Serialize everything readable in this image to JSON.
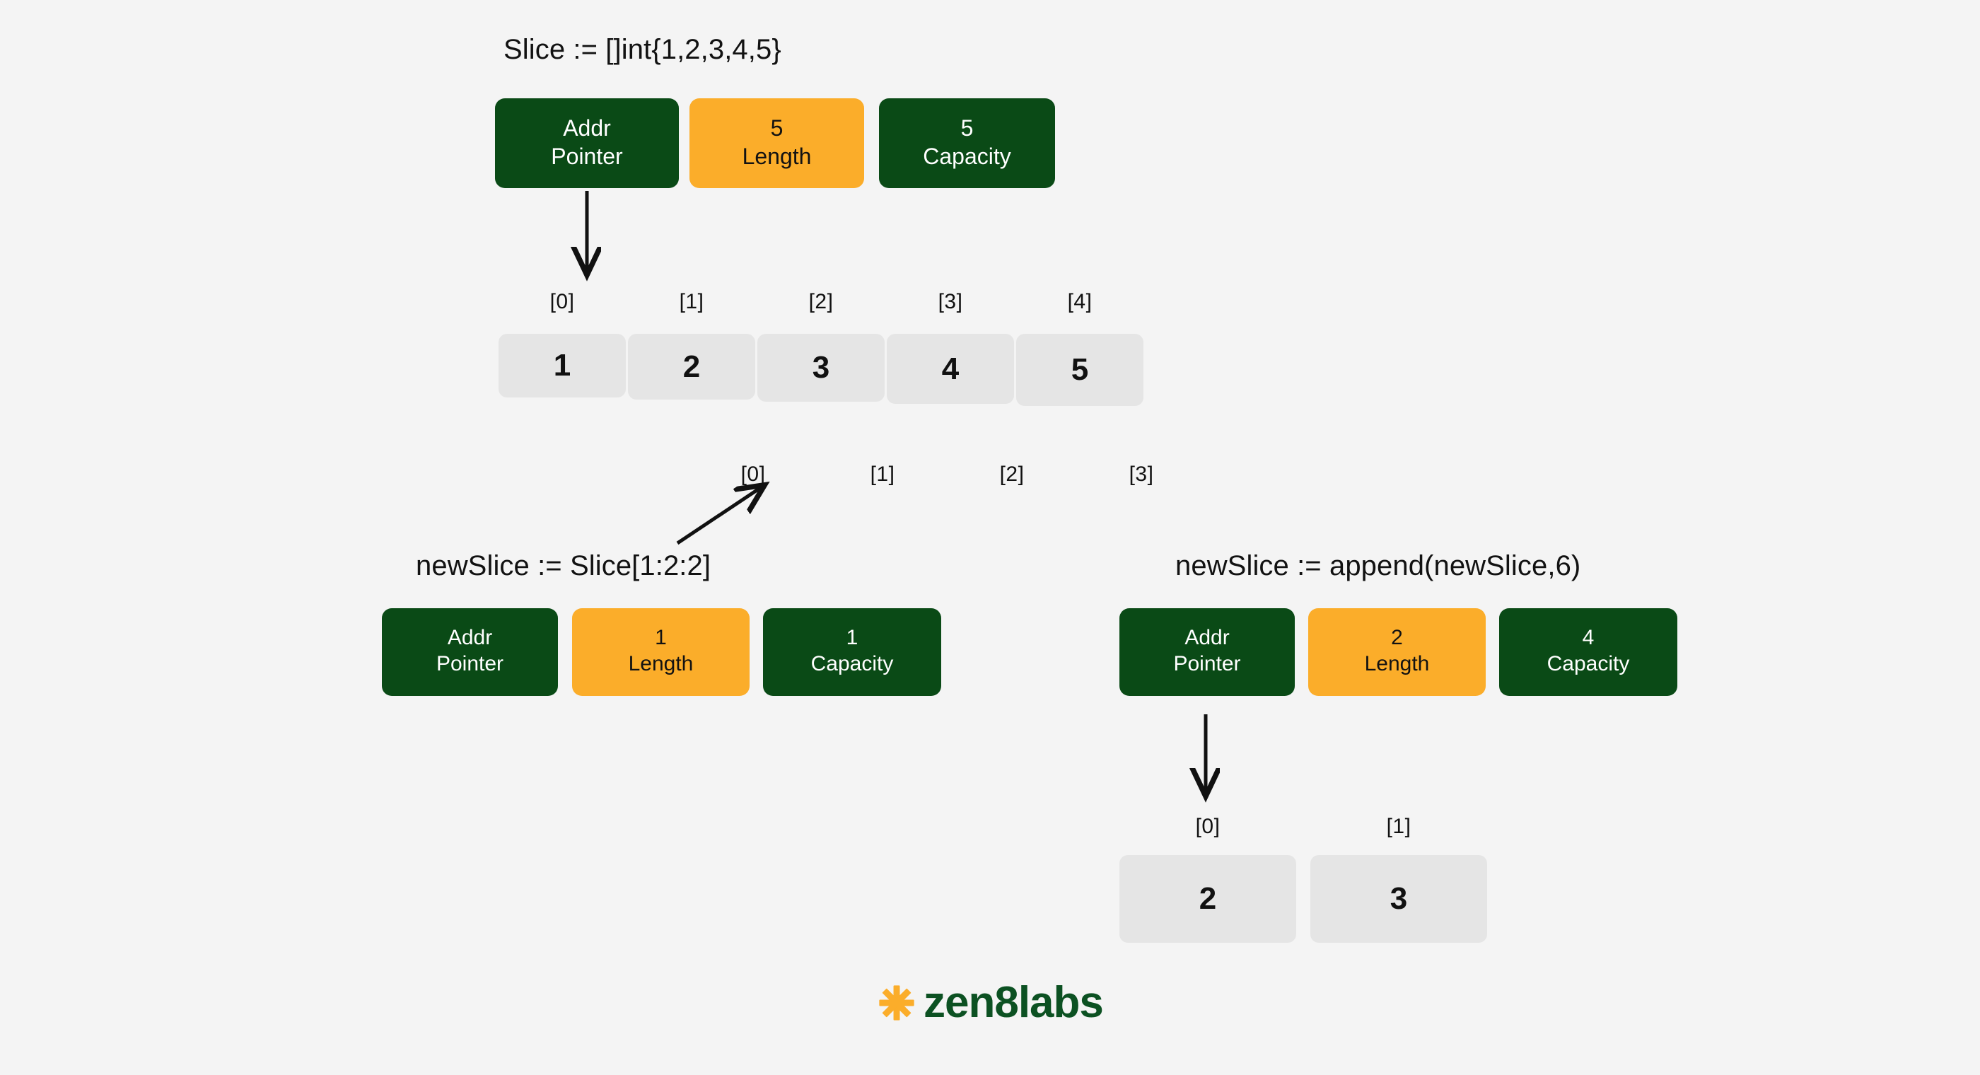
{
  "page": {
    "background_color": "#f4f4f4",
    "accent_green": "#0a4a16",
    "accent_orange": "#fbad2a",
    "cell_color": "#e5e5e5"
  },
  "top": {
    "caption": "Slice := []int{1,2,3,4,5}",
    "header": {
      "pointer": {
        "line1": "Addr",
        "line2": "Pointer"
      },
      "length": {
        "line1": "5",
        "line2": "Length"
      },
      "capacity": {
        "line1": "5",
        "line2": "Capacity"
      }
    },
    "array": {
      "top_indices": [
        "[0]",
        "[1]",
        "[2]",
        "[3]",
        "[4]"
      ],
      "values": [
        "1",
        "2",
        "3",
        "4",
        "5"
      ],
      "bottom_indices": [
        "[0]",
        "[1]",
        "[2]",
        "[3]"
      ]
    }
  },
  "bottom_left": {
    "caption": "newSlice := Slice[1:2:2]",
    "header": {
      "pointer": {
        "line1": "Addr",
        "line2": "Pointer"
      },
      "length": {
        "line1": "1",
        "line2": "Length"
      },
      "capacity": {
        "line1": "1",
        "line2": "Capacity"
      }
    }
  },
  "bottom_right": {
    "caption": "newSlice := append(newSlice,6)",
    "header": {
      "pointer": {
        "line1": "Addr",
        "line2": "Pointer"
      },
      "length": {
        "line1": "2",
        "line2": "Length"
      },
      "capacity": {
        "line1": "4",
        "line2": "Capacity"
      }
    },
    "array": {
      "indices": [
        "[0]",
        "[1]"
      ],
      "values": [
        "2",
        "3"
      ]
    }
  },
  "footer": {
    "logo_icon": "asterisk-icon",
    "logo_text": "zen8labs",
    "logo_icon_color": "#fbad2a",
    "logo_text_color": "#0c5122"
  }
}
